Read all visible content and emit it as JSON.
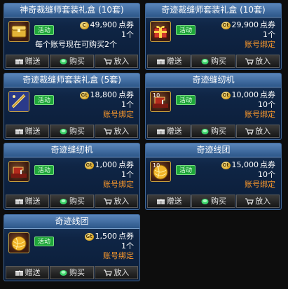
{
  "shop": {
    "items": [
      {
        "title": "神奇裁缝师套装礼盒 (10套)",
        "icon": "chest-icon",
        "tag": "活动",
        "coin_label": "C",
        "price": "49,900",
        "price_unit": "点券",
        "quantity": "1个",
        "note": "每个账号现在可购买2个",
        "bind": "",
        "buttons": {
          "gift": "赠送",
          "buy": "购买",
          "cart": "放入"
        }
      },
      {
        "title": "奇迹裁缝师套装礼盒 (10套)",
        "icon": "gift-box-icon",
        "tag": "活动",
        "coin_label": "Gt",
        "price": "29,900",
        "price_unit": "点券",
        "quantity": "1个",
        "note": "",
        "bind": "账号绑定",
        "buttons": {
          "gift": "赠送",
          "buy": "购买",
          "cart": "放入"
        }
      },
      {
        "title": "奇迹裁缝师套装礼盒 (5套)",
        "icon": "scroll-icon",
        "tag": "活动",
        "coin_label": "Gt",
        "price": "18,800",
        "price_unit": "点券",
        "quantity": "1个",
        "note": "",
        "bind": "账号绑定",
        "buttons": {
          "gift": "赠送",
          "buy": "购买",
          "cart": "放入"
        }
      },
      {
        "title": "奇迹缝纫机",
        "icon": "sewing-machine-icon",
        "icon_count": "10",
        "tag": "活动",
        "coin_label": "Gt",
        "price": "10,000",
        "price_unit": "点券",
        "quantity": "10个",
        "note": "",
        "bind": "账号绑定",
        "buttons": {
          "gift": "赠送",
          "buy": "购买",
          "cart": "放入"
        }
      },
      {
        "title": "奇迹缝纫机",
        "icon": "sewing-machine-icon",
        "tag": "活动",
        "coin_label": "Gt",
        "price": "1,000",
        "price_unit": "点券",
        "quantity": "1个",
        "note": "",
        "bind": "账号绑定",
        "buttons": {
          "gift": "赠送",
          "buy": "购买",
          "cart": "放入"
        }
      },
      {
        "title": "奇迹线团",
        "icon": "thread-ball-icon",
        "icon_count": "10",
        "tag": "活动",
        "coin_label": "Gt",
        "price": "15,000",
        "price_unit": "点券",
        "quantity": "10个",
        "note": "",
        "bind": "账号绑定",
        "buttons": {
          "gift": "赠送",
          "buy": "购买",
          "cart": "放入"
        }
      },
      {
        "title": "奇迹线团",
        "icon": "thread-ball-icon",
        "tag": "活动",
        "coin_label": "Gt",
        "price": "1,500",
        "price_unit": "点券",
        "quantity": "1个",
        "note": "",
        "bind": "账号绑定",
        "buttons": {
          "gift": "赠送",
          "buy": "购买",
          "cart": "放入"
        }
      }
    ]
  },
  "colors": {
    "title_bar": "#3d6ea5",
    "card_bg": "#0f2545",
    "event_badge": "#1fa63a",
    "bind_text": "#ff9a2a",
    "coin": "#d7a11e"
  }
}
